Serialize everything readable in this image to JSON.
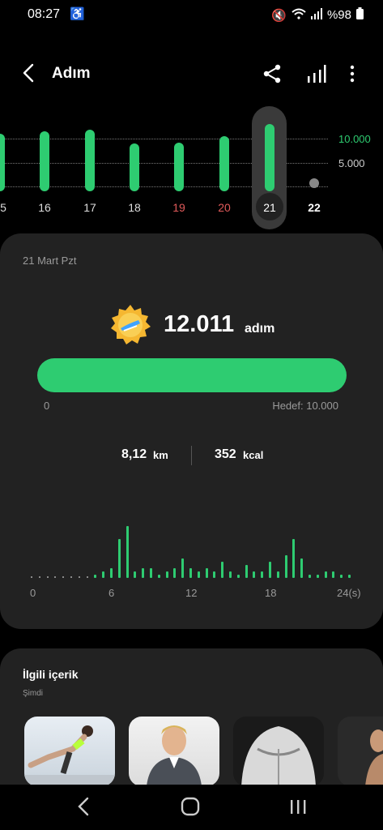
{
  "status": {
    "time": "08:27",
    "battery": "%98"
  },
  "header": {
    "title": "Adım"
  },
  "week": {
    "days": [
      "5",
      "16",
      "17",
      "18",
      "19",
      "20",
      "21",
      "22"
    ],
    "goal_hi": "10.000",
    "goal_lo": "5.000",
    "steps_fraction_of_10000": [
      1.0,
      1.05,
      1.09,
      0.8,
      0.82,
      0.95,
      1.2,
      0
    ]
  },
  "card": {
    "date": "21 Mart Pzt",
    "steps": "12.011",
    "unit": "adım",
    "progress_min": "0",
    "progress_goal": "Hedef: 10.000",
    "distance_value": "8,12",
    "distance_unit": "km",
    "calories_value": "352",
    "calories_unit": "kcal",
    "hist_axis": [
      "0",
      "6",
      "12",
      "18",
      "24(s)"
    ],
    "hourly_steps_relative": [
      0,
      0,
      0,
      0,
      0,
      0,
      0,
      0,
      0.05,
      0.1,
      0.15,
      0.6,
      0.8,
      0.1,
      0.15,
      0.15,
      0.05,
      0.1,
      0.15,
      0.3,
      0.15,
      0.1,
      0.15,
      0.1,
      0.25,
      0.1,
      0.05,
      0.2,
      0.1,
      0.1,
      0.25,
      0.1,
      0.35,
      0.6,
      0.3,
      0.05,
      0.05,
      0.1,
      0.1,
      0.05,
      0.05
    ]
  },
  "related": {
    "title": "İlgili içerik",
    "subtitle": "Şimdi"
  },
  "colors": {
    "accent": "#2ecc71",
    "card": "#222222",
    "red": "#e05a5a"
  }
}
